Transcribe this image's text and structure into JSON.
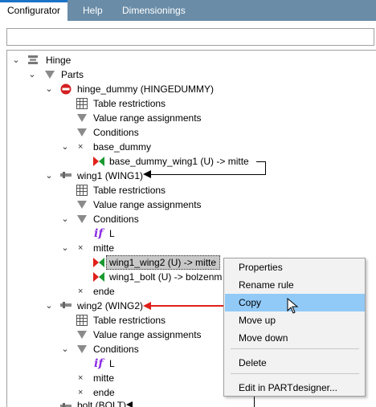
{
  "tabs": [
    "Configurator",
    "Help",
    "Dimensionings"
  ],
  "search": {
    "value": "",
    "placeholder": ""
  },
  "tree": {
    "hinge": "Hinge",
    "parts": "Parts",
    "hinge_dummy": {
      "name": "hinge_dummy (HINGEDUMMY)",
      "table_restrictions": "Table restrictions",
      "value_range": "Value range assignments",
      "conditions": "Conditions",
      "base_dummy": "base_dummy",
      "rule": "base_dummy_wing1 (U) -> mitte"
    },
    "wing1": {
      "name": "wing1 (WING1)",
      "table_restrictions": "Table restrictions",
      "value_range": "Value range assignments",
      "conditions": "Conditions",
      "if_label": "L",
      "mitte": "mitte",
      "rule1": "wing1_wing2 (U) -> mitte",
      "rule2": "wing1_bolt (U) -> bolzenm",
      "ende": "ende"
    },
    "wing2": {
      "name": "wing2 (WING2)",
      "table_restrictions": "Table restrictions",
      "value_range": "Value range assignments",
      "conditions": "Conditions",
      "if_label": "L",
      "mitte": "mitte",
      "ende": "ende"
    },
    "bolt": "bolt (BOLT)"
  },
  "context_menu": {
    "items": [
      "Properties",
      "Rename rule",
      "Copy",
      "Move up",
      "Move down",
      "Delete",
      "Edit in PARTdesigner..."
    ],
    "hovered": "Copy"
  },
  "colors": {
    "tabbar": "#6a8ca7",
    "arrow_red": "#e0201a",
    "menu_hover": "#91c9f7",
    "condition_if": "#8a2be2"
  }
}
